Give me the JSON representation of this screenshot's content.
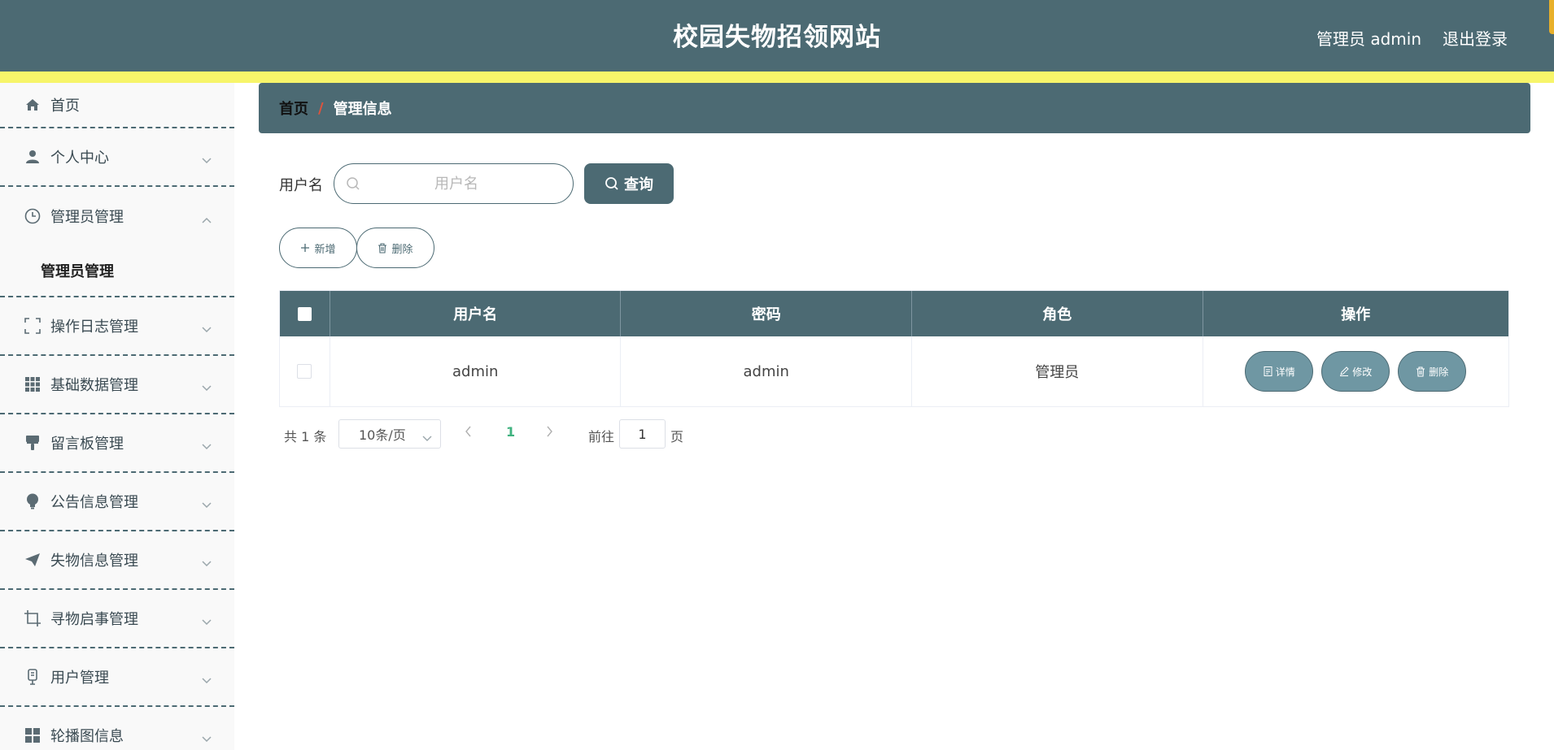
{
  "header": {
    "title": "校园失物招领网站",
    "user": "管理员 admin",
    "logout": "退出登录"
  },
  "sidebar": {
    "items": [
      {
        "label": "首页",
        "icon": "home-icon"
      },
      {
        "label": "个人中心",
        "icon": "user-icon"
      },
      {
        "label": "管理员管理",
        "icon": "clock-icon",
        "expanded": true,
        "children": [
          "管理员管理"
        ]
      },
      {
        "label": "操作日志管理",
        "icon": "frame-icon"
      },
      {
        "label": "基础数据管理",
        "icon": "grid-icon"
      },
      {
        "label": "留言板管理",
        "icon": "brush-icon"
      },
      {
        "label": "公告信息管理",
        "icon": "bulb-icon"
      },
      {
        "label": "失物信息管理",
        "icon": "send-icon"
      },
      {
        "label": "寻物启事管理",
        "icon": "crop-icon"
      },
      {
        "label": "用户管理",
        "icon": "mic-icon"
      },
      {
        "label": "轮播图信息",
        "icon": "menu-grid-icon"
      }
    ]
  },
  "breadcrumb": {
    "home": "首页",
    "separator": "/",
    "current": "管理信息"
  },
  "search": {
    "label": "用户名",
    "placeholder": "用户名",
    "value": "",
    "button": "查询"
  },
  "actions": {
    "add": "新增",
    "delete": "删除"
  },
  "table": {
    "columns": [
      "用户名",
      "密码",
      "角色",
      "操作"
    ],
    "rows": [
      {
        "username": "admin",
        "password": "admin",
        "role": "管理员"
      }
    ],
    "row_actions": {
      "detail": "详情",
      "edit": "修改",
      "delete": "删除"
    }
  },
  "pagination": {
    "total": "共 1 条",
    "page_size": "10条/页",
    "current_page": "1",
    "goto_label": "前往",
    "goto_value": "1",
    "page_suffix": "页"
  },
  "colors": {
    "primary": "#4c6a73",
    "stripe": "#f7f56a",
    "row_button": "#6f97a3",
    "active_page": "#3fb27f",
    "breadcrumb_separator": "#e0533c"
  }
}
